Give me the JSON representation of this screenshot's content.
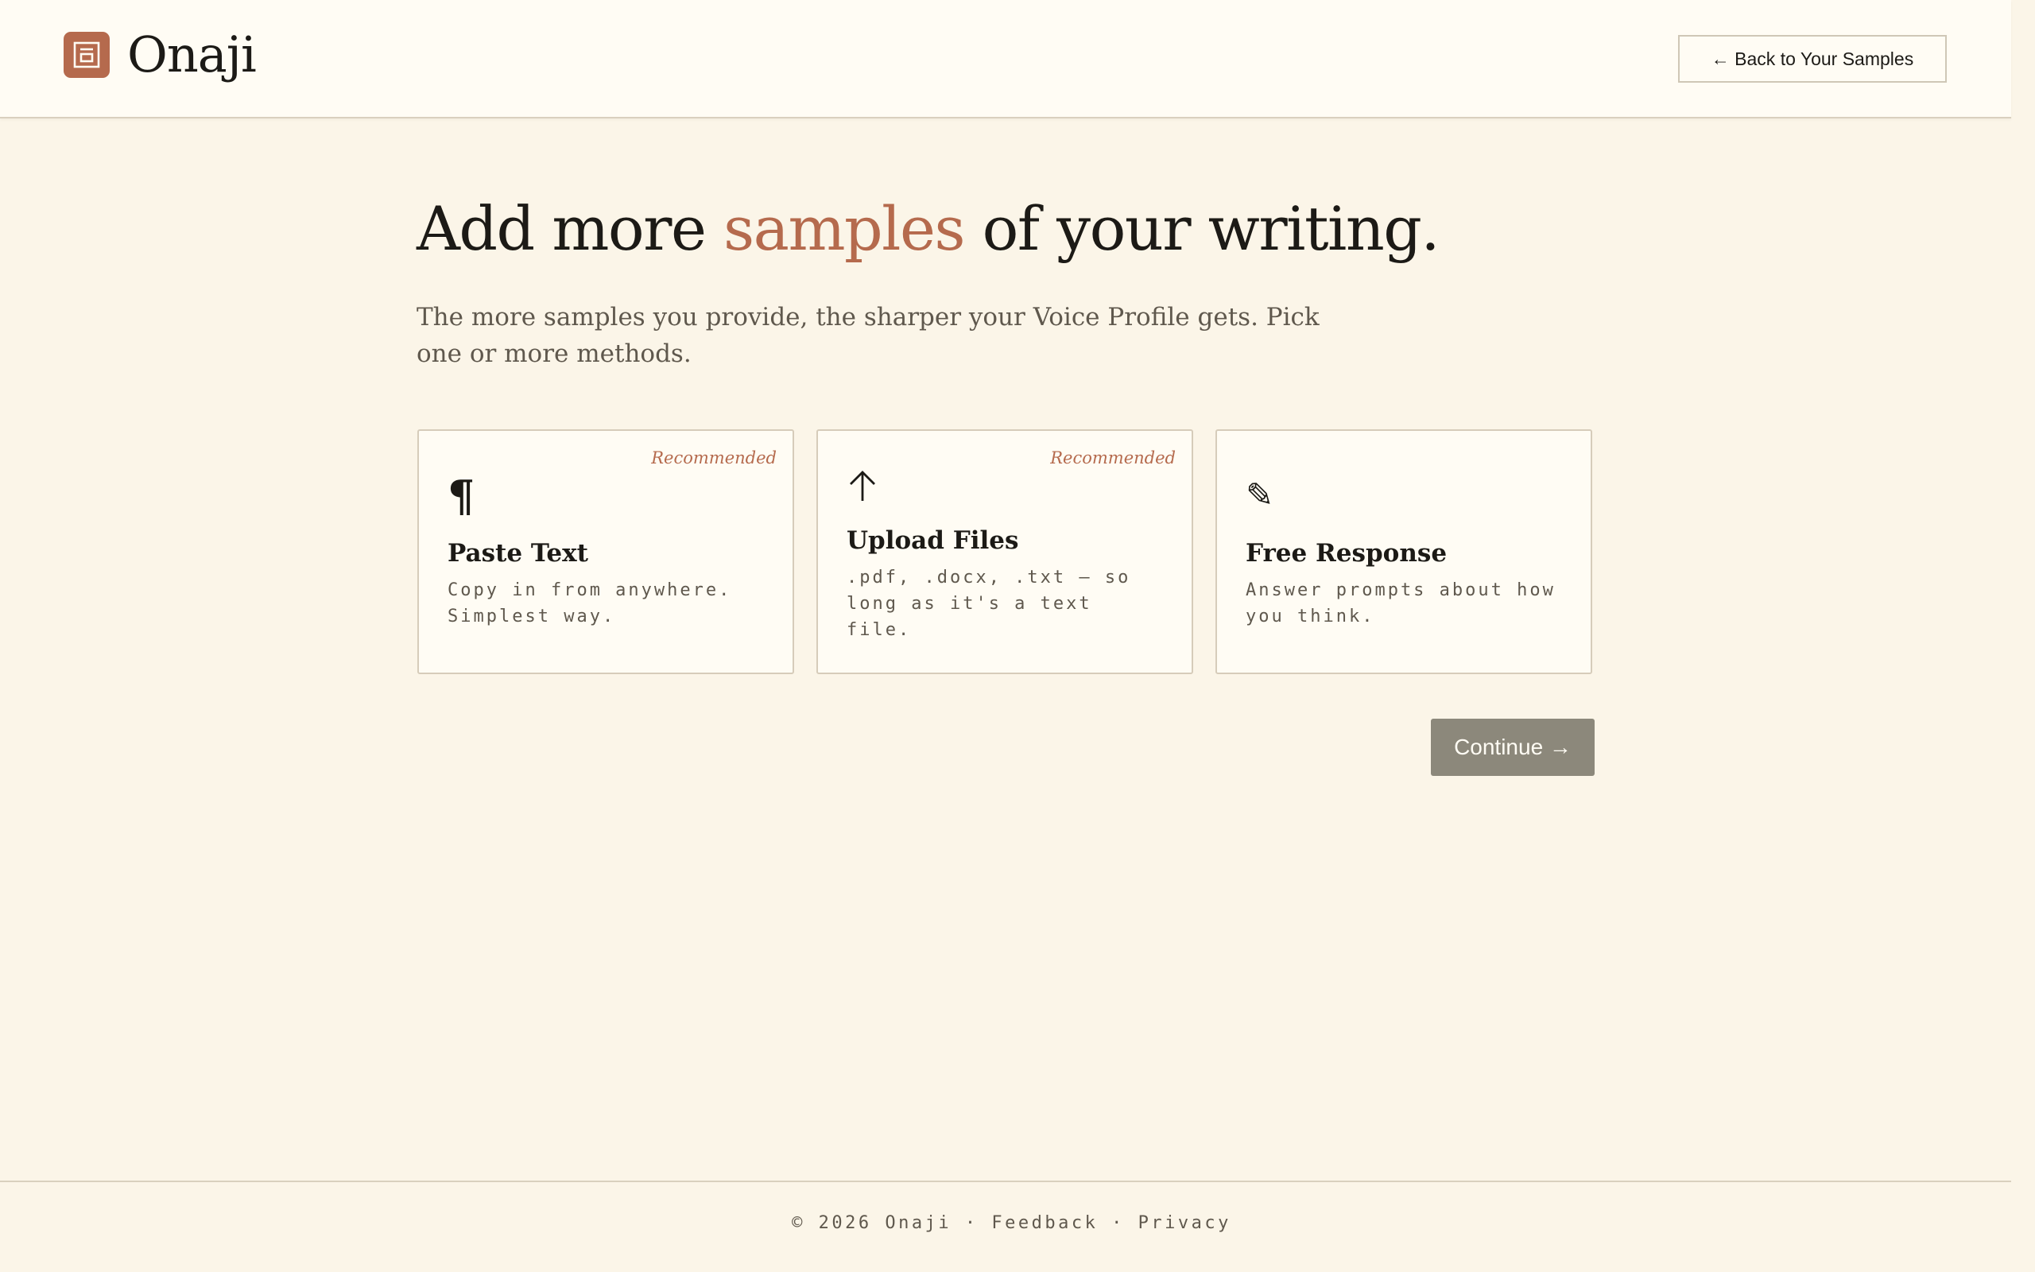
{
  "header": {
    "brand_name": "Onaji",
    "logo_icon": "stamp-logo-icon",
    "back_button_label": "← Back to Your Samples"
  },
  "hero": {
    "headline_before": "Add more ",
    "headline_accent": "samples",
    "headline_after": " of your writing.",
    "subtitle": "The more samples you provide, the sharper your Voice Profile gets. Pick one or more methods."
  },
  "methods": [
    {
      "badge": "Recommended",
      "icon": "pilcrow-icon",
      "icon_glyph": "¶",
      "title": "Paste Text",
      "description": "Copy in from anywhere. Simplest way."
    },
    {
      "badge": "Recommended",
      "icon": "upload-arrow-icon",
      "title": "Upload Files",
      "description": ".pdf, .docx, .txt — so long as it's a text file."
    },
    {
      "badge": "",
      "icon": "pencil-icon",
      "icon_glyph": "✎",
      "title": "Free Response",
      "description": "Answer prompts about how you think."
    }
  ],
  "actions": {
    "continue_label": "Continue →"
  },
  "footer": {
    "copyright": "© 2026 Onaji",
    "separator": " · ",
    "feedback": "Feedback",
    "privacy": "Privacy"
  },
  "colors": {
    "background": "#FBF5E8",
    "surface": "#FFFCF4",
    "accent": "#B56A4D",
    "text": "#1C1A16",
    "muted_text": "#5F584D",
    "border": "#D6CCBA",
    "continue_button": "#8C887B"
  }
}
